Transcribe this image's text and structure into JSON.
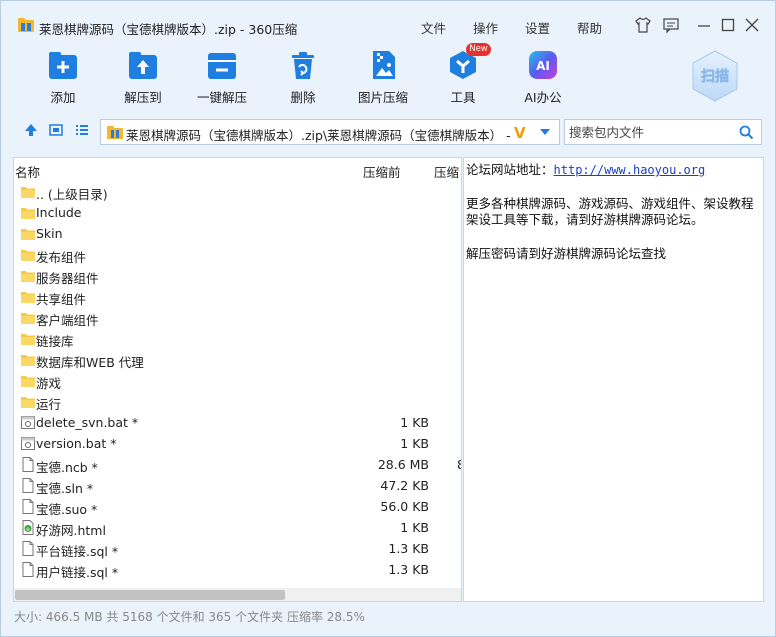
{
  "window": {
    "title": "莱恩棋牌源码（宝德棋牌版本）.zip - 360压缩",
    "menus": [
      "文件",
      "操作",
      "设置",
      "帮助"
    ]
  },
  "toolbar": {
    "items": [
      {
        "label": "添加",
        "icon": "add-icon"
      },
      {
        "label": "解压到",
        "icon": "extract-to-icon"
      },
      {
        "label": "一键解压",
        "icon": "one-click-extract-icon"
      },
      {
        "label": "删除",
        "icon": "delete-icon"
      },
      {
        "label": "图片压缩",
        "icon": "image-compress-icon"
      },
      {
        "label": "工具",
        "icon": "tools-icon",
        "badge": "New"
      },
      {
        "label": "AI办公",
        "icon": "ai-office-icon"
      }
    ],
    "scan_label": "扫描",
    "ai_text": "AI"
  },
  "address": {
    "path": "莱恩棋牌源码（宝德棋牌版本）.zip\\莱恩棋牌源码（宝德棋牌版本） - 解",
    "v_mark": "V",
    "search_placeholder": "搜索包内文件"
  },
  "columns": {
    "name": "名称",
    "size_before": "压缩前",
    "size_after": "压缩"
  },
  "files": [
    {
      "name": ".. (上级目录)",
      "type": "folder",
      "size": ""
    },
    {
      "name": "Include",
      "type": "folder",
      "size": ""
    },
    {
      "name": "Skin",
      "type": "folder",
      "size": ""
    },
    {
      "name": "发布组件",
      "type": "folder",
      "size": ""
    },
    {
      "name": "服务器组件",
      "type": "folder",
      "size": ""
    },
    {
      "name": "共享组件",
      "type": "folder",
      "size": ""
    },
    {
      "name": "客户端组件",
      "type": "folder",
      "size": ""
    },
    {
      "name": "链接库",
      "type": "folder",
      "size": ""
    },
    {
      "name": "数据库和WEB 代理",
      "type": "folder",
      "size": ""
    },
    {
      "name": "游戏",
      "type": "folder",
      "size": ""
    },
    {
      "name": "运行",
      "type": "folder",
      "size": ""
    },
    {
      "name": "delete_svn.bat *",
      "type": "bat",
      "size": "1 KB"
    },
    {
      "name": "version.bat *",
      "type": "bat",
      "size": "1 KB"
    },
    {
      "name": "宝德.ncb *",
      "type": "file",
      "size": "28.6 MB",
      "cut": "8"
    },
    {
      "name": "宝德.sln *",
      "type": "file",
      "size": "47.2 KB"
    },
    {
      "name": "宝德.suo *",
      "type": "file",
      "size": "56.0 KB"
    },
    {
      "name": "好游网.html",
      "type": "html",
      "size": "1 KB"
    },
    {
      "name": "平台链接.sql *",
      "type": "file",
      "size": "1.3 KB"
    },
    {
      "name": "用户链接.sql *",
      "type": "file",
      "size": "1.3 KB"
    }
  ],
  "info": {
    "site_label": "论坛网站地址：",
    "site_url": "http://www.haoyou.org",
    "line1": "更多各种棋牌源码、游戏源码、游戏组件、架设教程",
    "line2": "架设工具等下载，请到好游棋牌源码论坛。",
    "line3": "解压密码请到好游棋牌源码论坛查找"
  },
  "status": "大小: 466.5 MB 共 5168 个文件和 365 个文件夹 压缩率 28.5%",
  "colors": {
    "accent": "#1e7fe0",
    "background": "#eaf3fc",
    "link": "#1a3fbf"
  }
}
